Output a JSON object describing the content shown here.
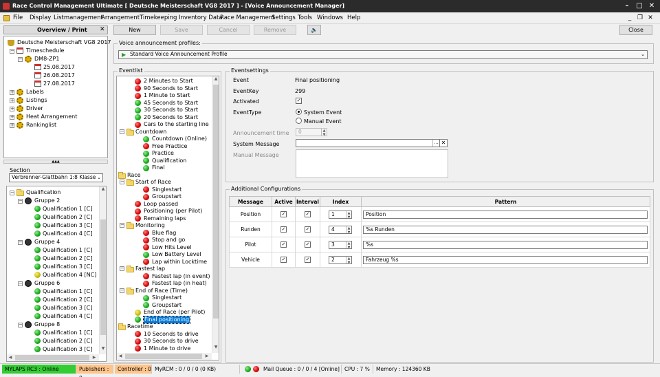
{
  "window": {
    "title": "Race Control Management Ultimate  [ Deutsche Meisterschaft VG8 2017 ] - [Voice Announcement Manager]"
  },
  "menu": [
    "File",
    "Display",
    "Listmanagement",
    "Arrangement",
    "Timekeeping",
    "Inventory Data",
    "Race Management",
    "Settings",
    "Tools",
    "Windows",
    "Help"
  ],
  "overview": {
    "title": "Overview / Print",
    "tree": [
      {
        "label": "Deutsche Meisterschaft VG8 2017"
      },
      {
        "label": "Timeschedule"
      },
      {
        "label": "DM8-ZP1"
      },
      {
        "label": "25.08.2017"
      },
      {
        "label": "26.08.2017"
      },
      {
        "label": "27.08.2017"
      },
      {
        "label": "Labels"
      },
      {
        "label": "Listings"
      },
      {
        "label": "Driver"
      },
      {
        "label": "Heat Arrangement"
      },
      {
        "label": "Rankinglist"
      }
    ]
  },
  "section": {
    "label": "Section",
    "value": "Verbrenner-Glattbahn 1:8 Klasse",
    "tree": [
      {
        "label": "Qualification"
      },
      {
        "label": "Gruppe 2"
      },
      {
        "label": "Qualification 1  [C]"
      },
      {
        "label": "Qualification 2  [C]"
      },
      {
        "label": "Qualification 3  [C]"
      },
      {
        "label": "Qualification 4  [C]"
      },
      {
        "label": "Gruppe 4"
      },
      {
        "label": "Qualification 1  [C]"
      },
      {
        "label": "Qualification 2  [C]"
      },
      {
        "label": "Qualification 3  [C]"
      },
      {
        "label": "Qualification 4  [NC]"
      },
      {
        "label": "Gruppe 6"
      },
      {
        "label": "Qualification 1  [C]"
      },
      {
        "label": "Qualification 2  [C]"
      },
      {
        "label": "Qualification 3  [C]"
      },
      {
        "label": "Qualification 4  [C]"
      },
      {
        "label": "Gruppe 8"
      },
      {
        "label": "Qualification 1  [C]"
      },
      {
        "label": "Qualification 2  [C]"
      },
      {
        "label": "Qualification 3  [C]"
      }
    ]
  },
  "toolbar": {
    "new": "New",
    "save": "Save",
    "cancel": "Cancel",
    "remove": "Remove",
    "close": "Close"
  },
  "profiles": {
    "label": "Voice announcement profiles:",
    "value": "Standard Voice Announcement Profile"
  },
  "eventlist": {
    "title": "Eventlist",
    "items": [
      {
        "label": "2 Minutes to Start",
        "kind": "r"
      },
      {
        "label": "90 Seconds to Start",
        "kind": "r"
      },
      {
        "label": "1 Minute to Start",
        "kind": "r"
      },
      {
        "label": "45 Seconds to Start",
        "kind": "g"
      },
      {
        "label": "30 Seconds to Start",
        "kind": "g"
      },
      {
        "label": "20 Seconds to Start",
        "kind": "g"
      },
      {
        "label": "Cars to the starting line",
        "kind": "r"
      },
      {
        "label": "Countdown",
        "kind": "folder"
      },
      {
        "label": "Countdown (Online)",
        "kind": "g"
      },
      {
        "label": "Free Practice",
        "kind": "r"
      },
      {
        "label": "Practice",
        "kind": "g"
      },
      {
        "label": "Qualification",
        "kind": "g"
      },
      {
        "label": "Final",
        "kind": "g"
      },
      {
        "label": "Race",
        "kind": "folder"
      },
      {
        "label": "Start of Race",
        "kind": "folder"
      },
      {
        "label": "Singlestart",
        "kind": "r"
      },
      {
        "label": "Groupstart",
        "kind": "r"
      },
      {
        "label": "Loop passed",
        "kind": "r"
      },
      {
        "label": "Positioning (per Pilot)",
        "kind": "r"
      },
      {
        "label": "Remaining laps",
        "kind": "r"
      },
      {
        "label": "Monitoring",
        "kind": "folder"
      },
      {
        "label": "Blue flag",
        "kind": "r"
      },
      {
        "label": "Stop and go",
        "kind": "r"
      },
      {
        "label": "Low Hits Level",
        "kind": "r"
      },
      {
        "label": "Low Battery Level",
        "kind": "g"
      },
      {
        "label": "Lap within Locktime",
        "kind": "r"
      },
      {
        "label": "Fastest lap",
        "kind": "folder"
      },
      {
        "label": "Fastest lap (in event)",
        "kind": "r"
      },
      {
        "label": "Fastest lap (in heat)",
        "kind": "r"
      },
      {
        "label": "End of Race (Time)",
        "kind": "folder"
      },
      {
        "label": "Singlestart",
        "kind": "g"
      },
      {
        "label": "Groupstart",
        "kind": "g"
      },
      {
        "label": "End of Race (per Pilot)",
        "kind": "y"
      },
      {
        "label": "Final positioning",
        "kind": "g"
      },
      {
        "label": "Racetime",
        "kind": "folder"
      },
      {
        "label": "10 Seconds to drive",
        "kind": "r"
      },
      {
        "label": "30 Seconds to drive",
        "kind": "r"
      },
      {
        "label": "1 Minute to drive",
        "kind": "r"
      }
    ]
  },
  "eventsettings": {
    "title": "Eventsettings",
    "event_label": "Event",
    "event_value": "Final positioning",
    "key_label": "EventKey",
    "key_value": "299",
    "activated_label": "Activated",
    "type_label": "EventType",
    "type_system": "System Event",
    "type_manual": "Manual Event",
    "time_label": "Announcement time",
    "time_value": "0",
    "sysmsg_label": "System Message",
    "manmsg_label": "Manual Message"
  },
  "additional": {
    "title": "Additional Configurations",
    "headers": [
      "Message",
      "Active",
      "Interval",
      "Index",
      "Pattern"
    ],
    "rows": [
      {
        "message": "Position",
        "index": "1",
        "pattern": "Position"
      },
      {
        "message": "Runden",
        "index": "4",
        "pattern": "%s Runden"
      },
      {
        "message": "Pilot",
        "index": "3",
        "pattern": "%s"
      },
      {
        "message": "Vehicle",
        "index": "2",
        "pattern": "Fahrzeug %s"
      }
    ]
  },
  "status": {
    "mylaps": "MYLAPS RC3 : Online",
    "publishers": "Publishers : 0",
    "controller": "Controller : 0",
    "myrcm": "MyRCM : 0 / 0 / 0 (0 KB)",
    "mailqueue": "Mail Queue : 0 / 0 / 4 [Online]",
    "cpu": "CPU : 7 %",
    "memory": "Memory : 124360 KB"
  },
  "colors": {
    "status_green": "#33cc33",
    "status_orange": "#ffc48a",
    "selection": "#0078d7"
  }
}
